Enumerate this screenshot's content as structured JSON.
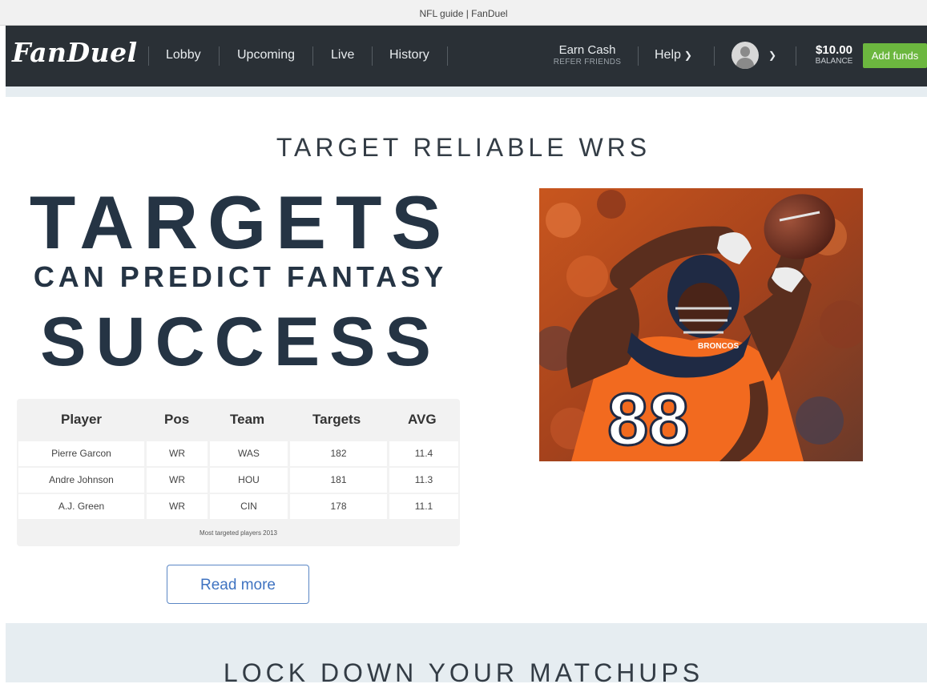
{
  "window": {
    "title": "NFL guide | FanDuel"
  },
  "nav": {
    "logo": "FanDuel",
    "links": [
      "Lobby",
      "Upcoming",
      "Live",
      "History"
    ],
    "earn_cash": "Earn Cash",
    "refer_friends": "REFER FRIENDS",
    "help": "Help",
    "balance_amount": "$10.00",
    "balance_label": "BALANCE",
    "add_funds": "Add funds"
  },
  "hero": {
    "section_title": "TARGET RELIABLE WRS",
    "line1": "TARGETS",
    "line2": "CAN PREDICT FANTASY",
    "line3": "SUCCESS"
  },
  "table": {
    "headers": [
      "Player",
      "Pos",
      "Team",
      "Targets",
      "AVG"
    ],
    "rows": [
      [
        "Pierre Garcon",
        "WR",
        "WAS",
        "182",
        "11.4"
      ],
      [
        "Andre Johnson",
        "WR",
        "HOU",
        "181",
        "11.3"
      ],
      [
        "A.J. Green",
        "WR",
        "CIN",
        "178",
        "11.1"
      ]
    ],
    "caption": "Most targeted players 2013"
  },
  "read_more": "Read more",
  "photo": {
    "jersey_number": "88",
    "helmet_text": "BRONCOS"
  },
  "next_section": {
    "title": "LOCK DOWN YOUR MATCHUPS"
  },
  "colors": {
    "nav_bg": "#2a3036",
    "accent_green": "#6cb73f",
    "link_blue": "#3f73c1",
    "heading": "#253444"
  }
}
